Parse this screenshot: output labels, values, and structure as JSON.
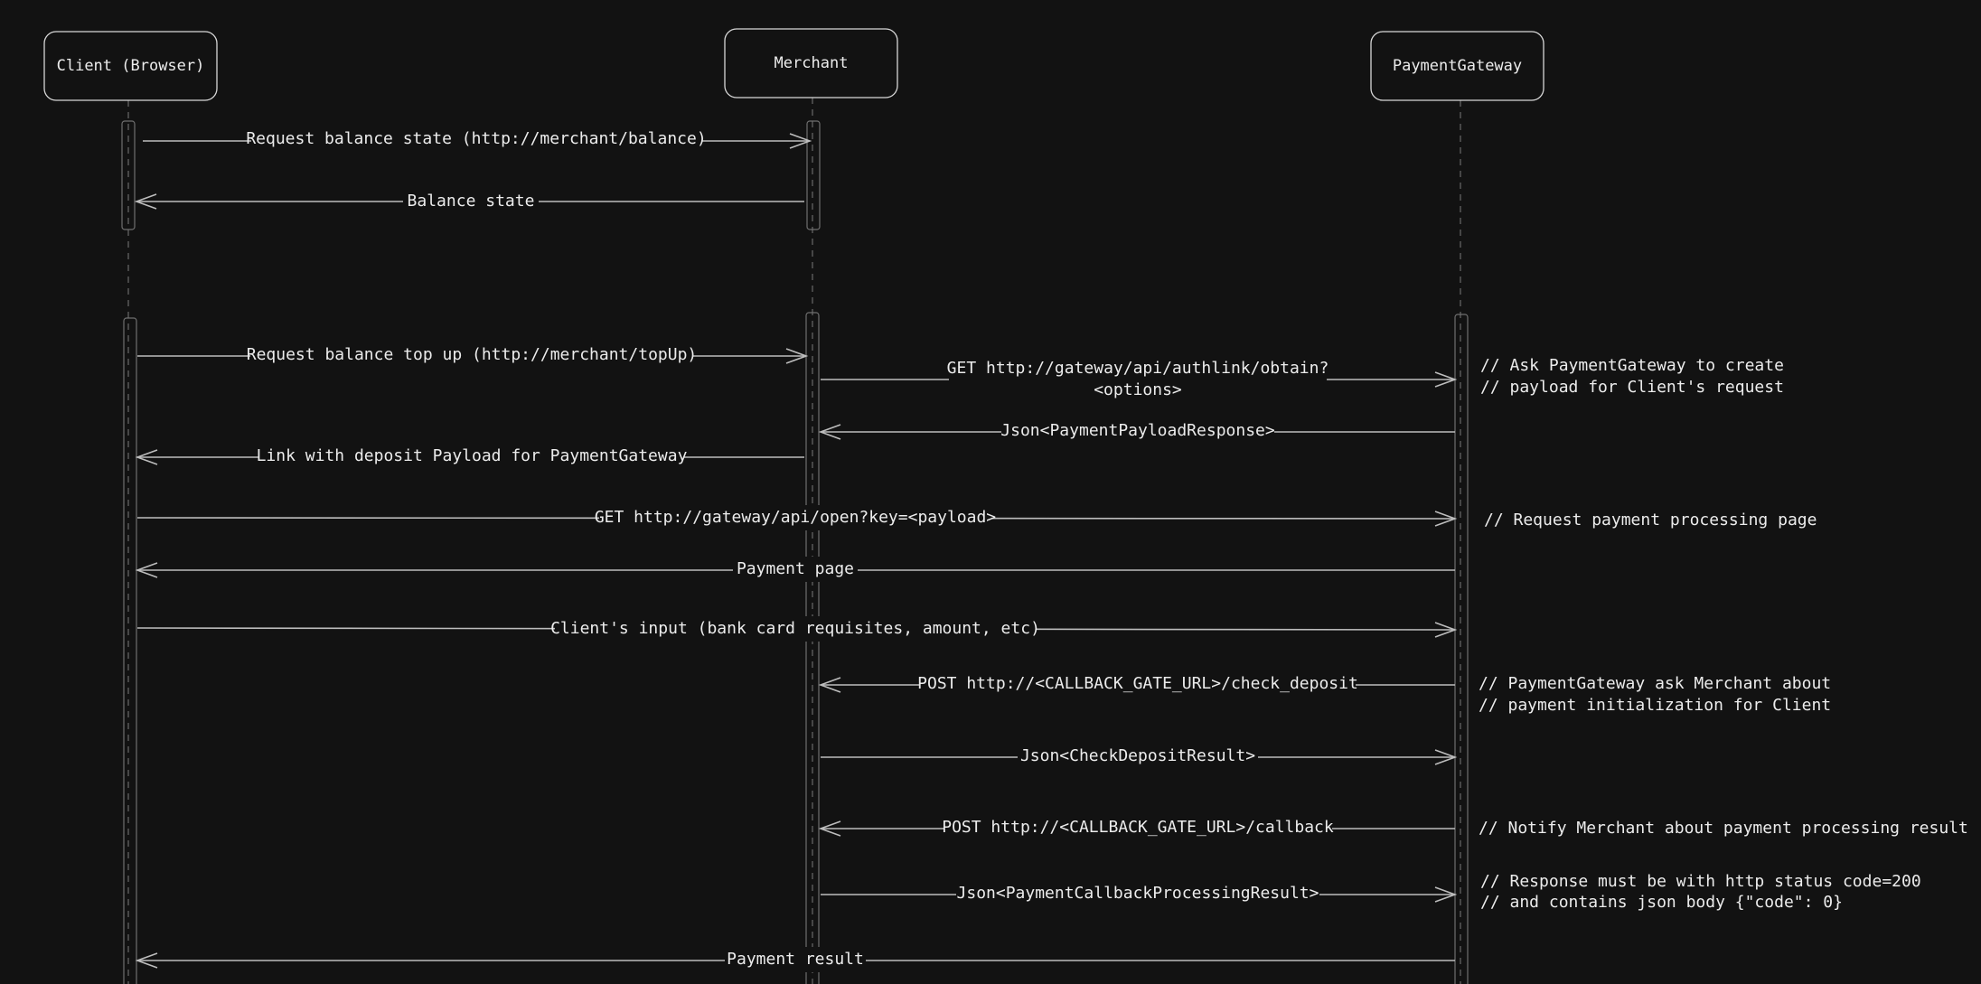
{
  "participants": [
    {
      "id": "client",
      "label": "Client (Browser)"
    },
    {
      "id": "merchant",
      "label": "Merchant"
    },
    {
      "id": "gateway",
      "label": "PaymentGateway"
    }
  ],
  "messages": [
    {
      "id": "m1",
      "from": "client",
      "to": "merchant",
      "lines": [
        "Request balance state (http://merchant/balance)"
      ]
    },
    {
      "id": "m2",
      "from": "merchant",
      "to": "client",
      "lines": [
        "Balance state"
      ]
    },
    {
      "id": "m3",
      "from": "client",
      "to": "merchant",
      "lines": [
        "Request balance top up (http://merchant/topUp)"
      ]
    },
    {
      "id": "m4",
      "from": "merchant",
      "to": "gateway",
      "lines": [
        "GET http://gateway/api/authlink/obtain?",
        "<options>"
      ]
    },
    {
      "id": "m5",
      "from": "gateway",
      "to": "merchant",
      "lines": [
        "Json<PaymentPayloadResponse>"
      ]
    },
    {
      "id": "m6",
      "from": "merchant",
      "to": "client",
      "lines": [
        "Link with deposit Payload for PaymentGateway"
      ]
    },
    {
      "id": "m7",
      "from": "client",
      "to": "gateway",
      "lines": [
        "GET http://gateway/api/open?key=<payload>"
      ]
    },
    {
      "id": "m8",
      "from": "gateway",
      "to": "client",
      "lines": [
        "Payment page"
      ]
    },
    {
      "id": "m9",
      "from": "client",
      "to": "gateway",
      "lines": [
        "Client's input (bank card requisites, amount, etc)"
      ]
    },
    {
      "id": "m10",
      "from": "gateway",
      "to": "merchant",
      "lines": [
        "POST http://<CALLBACK_GATE_URL>/check_deposit"
      ]
    },
    {
      "id": "m11",
      "from": "merchant",
      "to": "gateway",
      "lines": [
        "Json<CheckDepositResult>"
      ]
    },
    {
      "id": "m12",
      "from": "gateway",
      "to": "merchant",
      "lines": [
        "POST http://<CALLBACK_GATE_URL>/callback"
      ]
    },
    {
      "id": "m13",
      "from": "merchant",
      "to": "gateway",
      "lines": [
        "Json<PaymentCallbackProcessingResult>"
      ]
    },
    {
      "id": "m14",
      "from": "gateway",
      "to": "client",
      "lines": [
        "Payment result"
      ]
    }
  ],
  "notes": [
    {
      "id": "n1",
      "lines": [
        "// Ask PaymentGateway to create",
        "// payload for Client's request"
      ]
    },
    {
      "id": "n2",
      "lines": [
        "// Request payment processing page"
      ]
    },
    {
      "id": "n3",
      "lines": [
        "// PaymentGateway ask Merchant about",
        "// payment initialization for Client"
      ]
    },
    {
      "id": "n4",
      "lines": [
        "// Notify Merchant about payment processing result"
      ]
    },
    {
      "id": "n5",
      "lines": [
        "// Response must be with http status code=200",
        "// and contains json body {\"code\": 0}"
      ]
    }
  ],
  "colors": {
    "background": "#121212",
    "line": "#bdbdbd",
    "text": "#ececec"
  }
}
